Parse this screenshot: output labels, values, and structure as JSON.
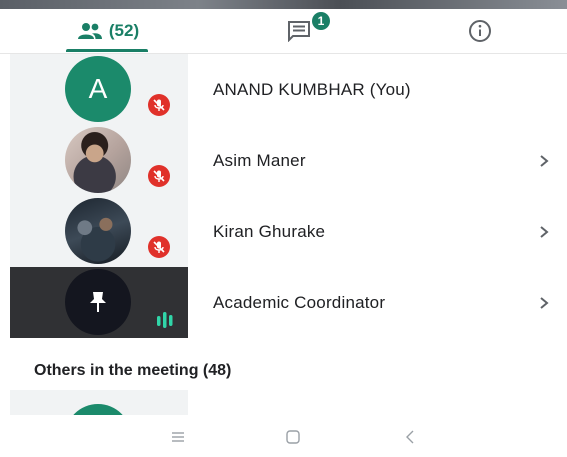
{
  "tabs": {
    "people_count": "(52)",
    "chat_badge": "1"
  },
  "participants": [
    {
      "initial": "A",
      "name": "ANAND KUMBHAR (You)",
      "muted": true,
      "has_chevron": false
    },
    {
      "name": "Asim Maner",
      "muted": true,
      "has_chevron": true
    },
    {
      "name": "Kiran Ghurake",
      "muted": true,
      "has_chevron": true
    },
    {
      "name": "Academic Coordinator",
      "pinned": true,
      "speaking": true,
      "has_chevron": true
    }
  ],
  "others": {
    "title": "Others in the meeting (48)"
  },
  "icons": {
    "people_tab": "people-icon",
    "chat_tab": "chat-icon",
    "info_tab": "info-icon",
    "mute": "mic-off-icon",
    "chevron": "chevron-right-icon",
    "pin": "pin-icon",
    "audio": "audio-level-icon",
    "nav_menu": "menu-icon",
    "nav_home": "home-icon",
    "nav_back": "back-icon"
  },
  "colors": {
    "accent": "#1a7f66",
    "muted_red": "#e0312a",
    "tile_bg": "#f1f3f4",
    "tile_dark": "#303134",
    "speaking": "#30d5a8"
  }
}
